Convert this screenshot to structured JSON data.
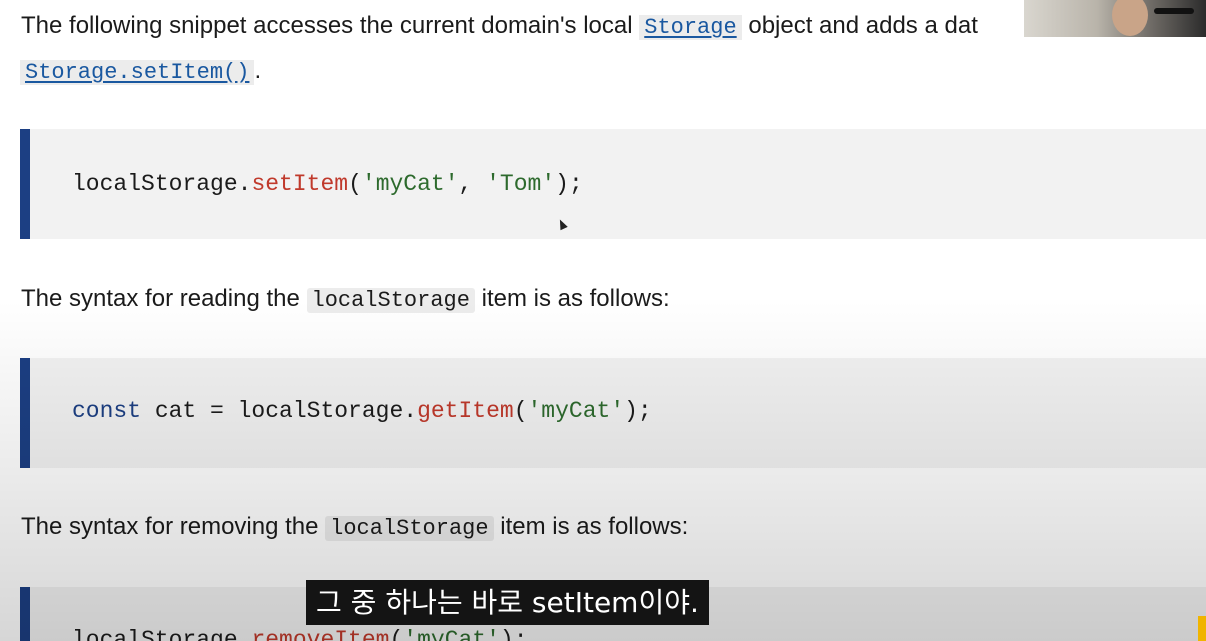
{
  "intro": {
    "text_before": "The following snippet accesses the current domain's local",
    "storage_link": "Storage",
    "text_after": "object and adds a dat",
    "setitem_link": "Storage.setItem()",
    "end_punct": "."
  },
  "block1": {
    "obj": "localStorage",
    "dot": ".",
    "method": "setItem",
    "open": "(",
    "arg1": "'myCat'",
    "comma": ", ",
    "arg2": "'Tom'",
    "close": ");"
  },
  "para2": {
    "text_before": "The syntax for reading the",
    "code": "localStorage",
    "text_after": "item is as follows:"
  },
  "block2": {
    "kw": "const",
    "rest": " cat = localStorage.",
    "method": "getItem",
    "open": "(",
    "arg": "'myCat'",
    "close": ");"
  },
  "para3": {
    "text_before": "The syntax for removing the",
    "code": "localStorage",
    "text_after": "item is as follows:"
  },
  "block3": {
    "obj": "localStorage.",
    "method": "removeItem",
    "open": "(",
    "arg": "'myCat'",
    "close": ");"
  },
  "subtitle": {
    "text": "그 중 하나는 바로 setItem이야."
  },
  "colors": {
    "border_accent": "#1c3f83",
    "link": "#1a58a0",
    "function": "#c0392b",
    "string": "#2d6a2d",
    "keyword": "#1c3f83"
  }
}
